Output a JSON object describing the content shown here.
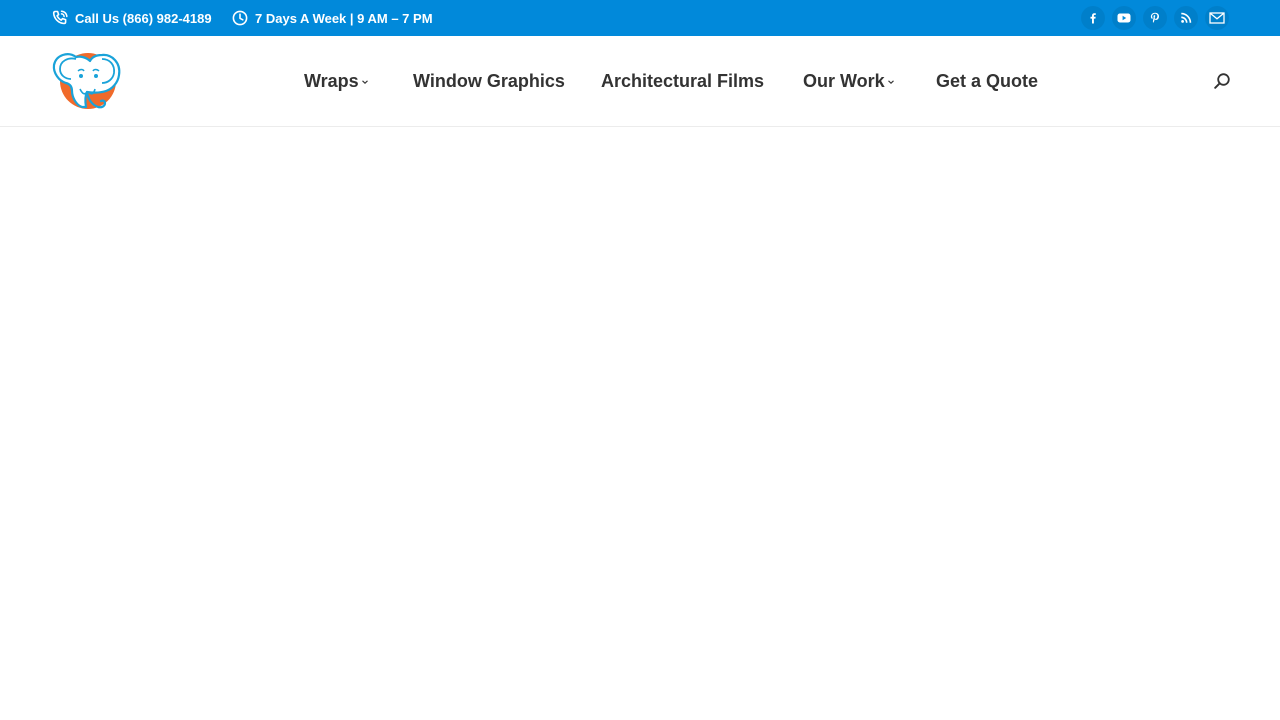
{
  "topbar": {
    "phone": {
      "label": "Call Us (866) 982-4189",
      "icon": "phone-icon"
    },
    "hours": {
      "label": "7 Days A Week | 9 AM – 7 PM",
      "icon": "clock-icon"
    },
    "social": [
      {
        "name": "facebook",
        "icon": "facebook-icon"
      },
      {
        "name": "youtube",
        "icon": "youtube-icon"
      },
      {
        "name": "pinterest",
        "icon": "pinterest-icon"
      },
      {
        "name": "rss",
        "icon": "rss-icon"
      },
      {
        "name": "email",
        "icon": "mail-icon"
      }
    ]
  },
  "header": {
    "logo": {
      "icon": "elephant-logo"
    },
    "nav": [
      {
        "label": "Wraps",
        "has_dropdown": true
      },
      {
        "label": "Window Graphics",
        "has_dropdown": false
      },
      {
        "label": "Architectural Films",
        "has_dropdown": false
      },
      {
        "label": "Our Work",
        "has_dropdown": true
      },
      {
        "label": "Get a Quote",
        "has_dropdown": false
      }
    ],
    "search": {
      "icon": "search-icon"
    }
  },
  "colors": {
    "topbar_bg": "#0189da",
    "nav_text": "#333333",
    "logo_blue": "#1aa3d9",
    "logo_orange": "#f06a2a"
  }
}
